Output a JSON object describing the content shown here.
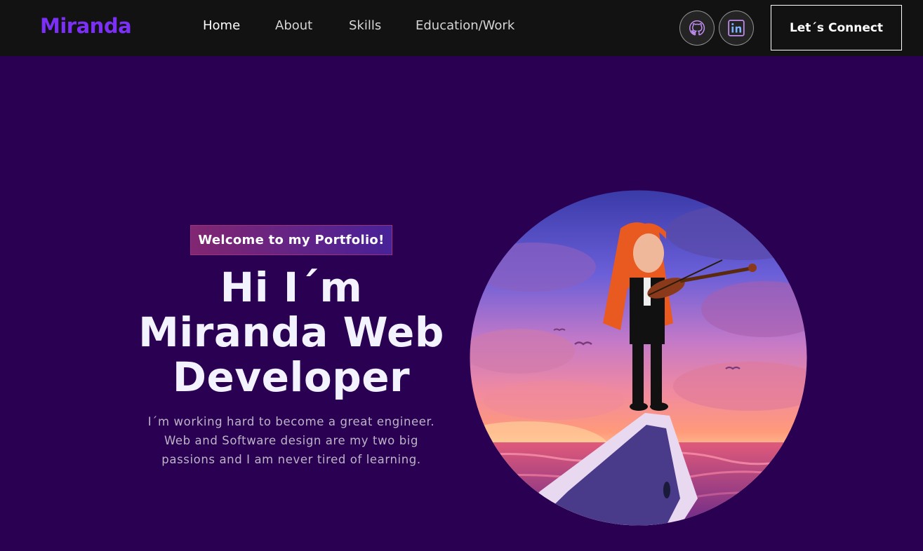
{
  "nav": {
    "brand": "Miranda",
    "links": [
      "Home",
      "About",
      "Skills",
      "Education/Work"
    ],
    "social": [
      "github-icon",
      "linkedin-icon"
    ],
    "connect_label": "Let´s Connect"
  },
  "hero": {
    "tagline": "Welcome to my Portfolio!",
    "headline_line1": "Hi I´m",
    "headline_line2": "Miranda Web",
    "headline_line3": "Developer",
    "description_line1": "I´m working hard to become a great engineer.",
    "description_line2": "Web and Software design are my two big",
    "description_line3": "passions and I am never tired of learning."
  },
  "colors": {
    "background": "#2a0052",
    "navbar": "#121212",
    "brand": "#7b2ff7",
    "tagline_gradient_start": "#aa367c",
    "tagline_gradient_end": "#4a2fbd"
  }
}
